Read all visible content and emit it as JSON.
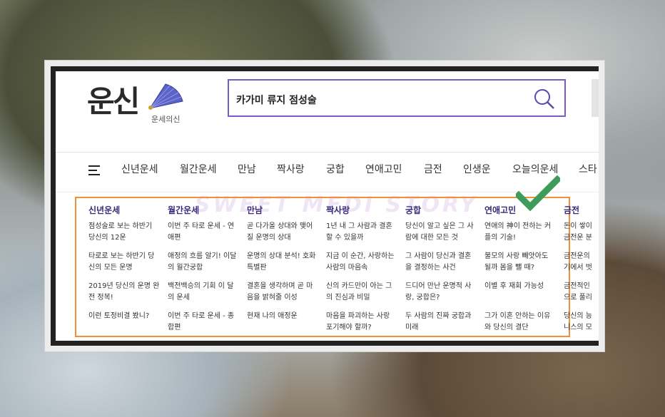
{
  "logo": {
    "main": "운신",
    "sub": "운세의신"
  },
  "search": {
    "value": "카가미 류지 점성술"
  },
  "nav": [
    "신년운세",
    "월간운세",
    "만남",
    "짝사랑",
    "궁합",
    "연애고민",
    "금전",
    "인생운",
    "오늘의운세",
    "스타"
  ],
  "watermark": "SWEET MEDI STORY",
  "columns": [
    {
      "title": "신년운세",
      "items": [
        "점성술로 보는 하반기 당신의 12운",
        "타로로 보는 하반기 당신의 모든 운명",
        "2019년 당신의 운명 완전 정복!",
        "이런 토정비결 봤니?"
      ]
    },
    {
      "title": "월간운세",
      "items": [
        "이번 주 타로 운세 - 연애편",
        "애정의 흐름 알기! 이달의 월간궁합",
        "백전백승의 기회 이 달의 운세",
        "이번 주 타로 운세 - 종합편"
      ]
    },
    {
      "title": "만남",
      "items": [
        "곧 다가올 상대와 맺어질 운명의 상대",
        "운명의 상대 분석! 호화특별판",
        "결혼을 생각하며 곧 마음을 밝혀줄 이성",
        "현재 나의 애정운"
      ]
    },
    {
      "title": "짝사랑",
      "items": [
        "1년 내 그 사람과 결혼할 수 있을까",
        "지금 이 순간, 사랑하는 사람의 마음속",
        "신의 카드만이 아는 그의 진심과 비밀",
        "마음을 파괴하는 사랑 포기해야 할까?"
      ]
    },
    {
      "title": "궁합",
      "items": [
        "당신이 알고 싶은 그 사람에 대한 모든 것",
        "그 사람이 당신과 결혼을 결정하는 사건",
        "드디어 만난 운명적 사랑, 궁합은?",
        "두 사람의 진짜 궁합과 미래"
      ]
    },
    {
      "title": "연애고민",
      "items": [
        "연애의 神이 전하는 커플의 기술!",
        "불모의 사랑 빼앗아도 될까 몸을 뺄 때?",
        "이별 후 재회 가능성",
        "그가 이혼 안하는 이유와 당신의 결단"
      ]
    },
    {
      "title": "금전",
      "items": [
        "돈이 쌓이 금전운 분",
        "금전운의 기에서 벗",
        "금전적인 으로 풀리",
        "당신의 능 니스의 모"
      ]
    }
  ],
  "colors": {
    "accent": "#7b5cc7",
    "highlight": "#f0913a",
    "check": "#3f9b5a"
  },
  "icons": [
    "fan-icon",
    "search-icon",
    "hamburger-icon",
    "checkmark-icon"
  ]
}
